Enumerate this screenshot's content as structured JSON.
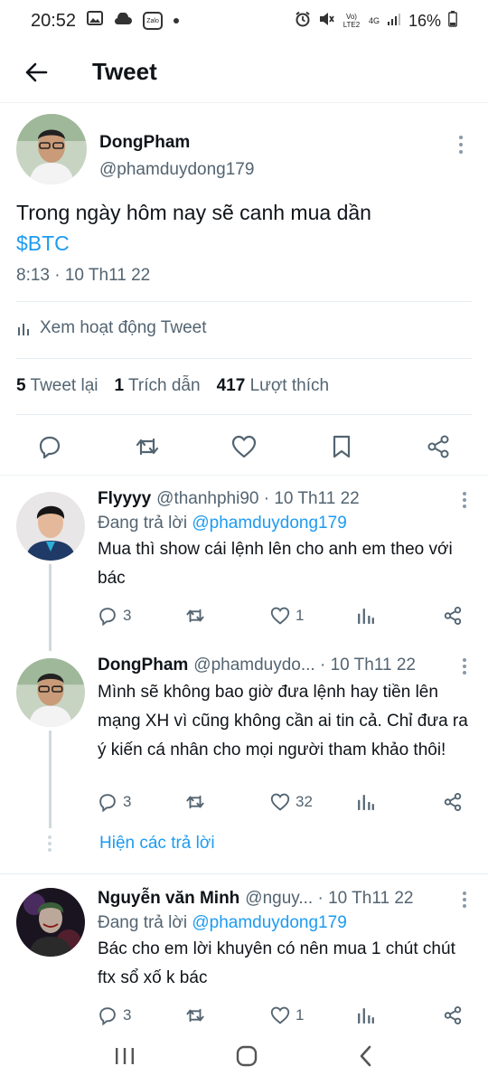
{
  "status_bar": {
    "time": "20:52",
    "left_icons": [
      "image-icon",
      "cloud-icon",
      "zalo-icon",
      "dot-icon"
    ],
    "zalo_text": "Zalo",
    "right_icons": [
      "alarm-icon",
      "mute-icon",
      "volte-icon",
      "4g-icon",
      "signal-icon",
      "battery-icon"
    ],
    "volte_text": "Vo) LTE2",
    "network_text": "4G",
    "battery": "16%"
  },
  "header": {
    "title": "Tweet"
  },
  "main_tweet": {
    "name": "DongPham",
    "handle": "@phamduydong179",
    "text": "Trong ngày hôm nay sẽ canh mua dần",
    "cashtag": "$BTC",
    "timestamp": "8:13 · 10 Th11 22",
    "analytics_label": "Xem hoạt động Tweet",
    "stats": {
      "retweets_count": "5",
      "retweets_label": "Tweet lại",
      "quotes_count": "1",
      "quotes_label": "Trích dẫn",
      "likes_count": "417",
      "likes_label": "Lượt thích"
    }
  },
  "replies": [
    {
      "name": "Flyyyy",
      "meta": "@thanhphi90 · 10 Th11 22",
      "replying_prefix": "Đang trả lời",
      "replying_to": "@phamduydong179",
      "text": "Mua thì show cái lệnh lên cho anh em theo với bác",
      "reply_count": "3",
      "retweet_count": "",
      "like_count": "1"
    },
    {
      "name": "DongPham",
      "meta": "@phamduydo... · 10 Th11 22",
      "text": "Mình sẽ không bao giờ đưa lệnh hay tiền lên mạng XH vì cũng không cần ai tin cả. Chỉ đưa ra ý kiến cá nhân cho mọi người tham khảo thôi!",
      "reply_count": "3",
      "retweet_count": "",
      "like_count": "32"
    },
    {
      "name": "Nguyễn văn Minh",
      "meta": "@nguy... · 10 Th11 22",
      "replying_prefix": "Đang trả lời",
      "replying_to": "@phamduydong179",
      "text": "Bác cho em lời khuyên có nên mua 1 chút chút ftx sổ xố k bác",
      "reply_count": "3",
      "retweet_count": "",
      "like_count": "1"
    }
  ],
  "show_replies_label": "Hiện các trả lời",
  "nav_bar": {
    "icons": [
      "recent-apps-icon",
      "home-icon",
      "back-icon"
    ]
  },
  "colors": {
    "accent": "#1d9bf0",
    "text": "#0f1419",
    "secondary": "#536471"
  }
}
